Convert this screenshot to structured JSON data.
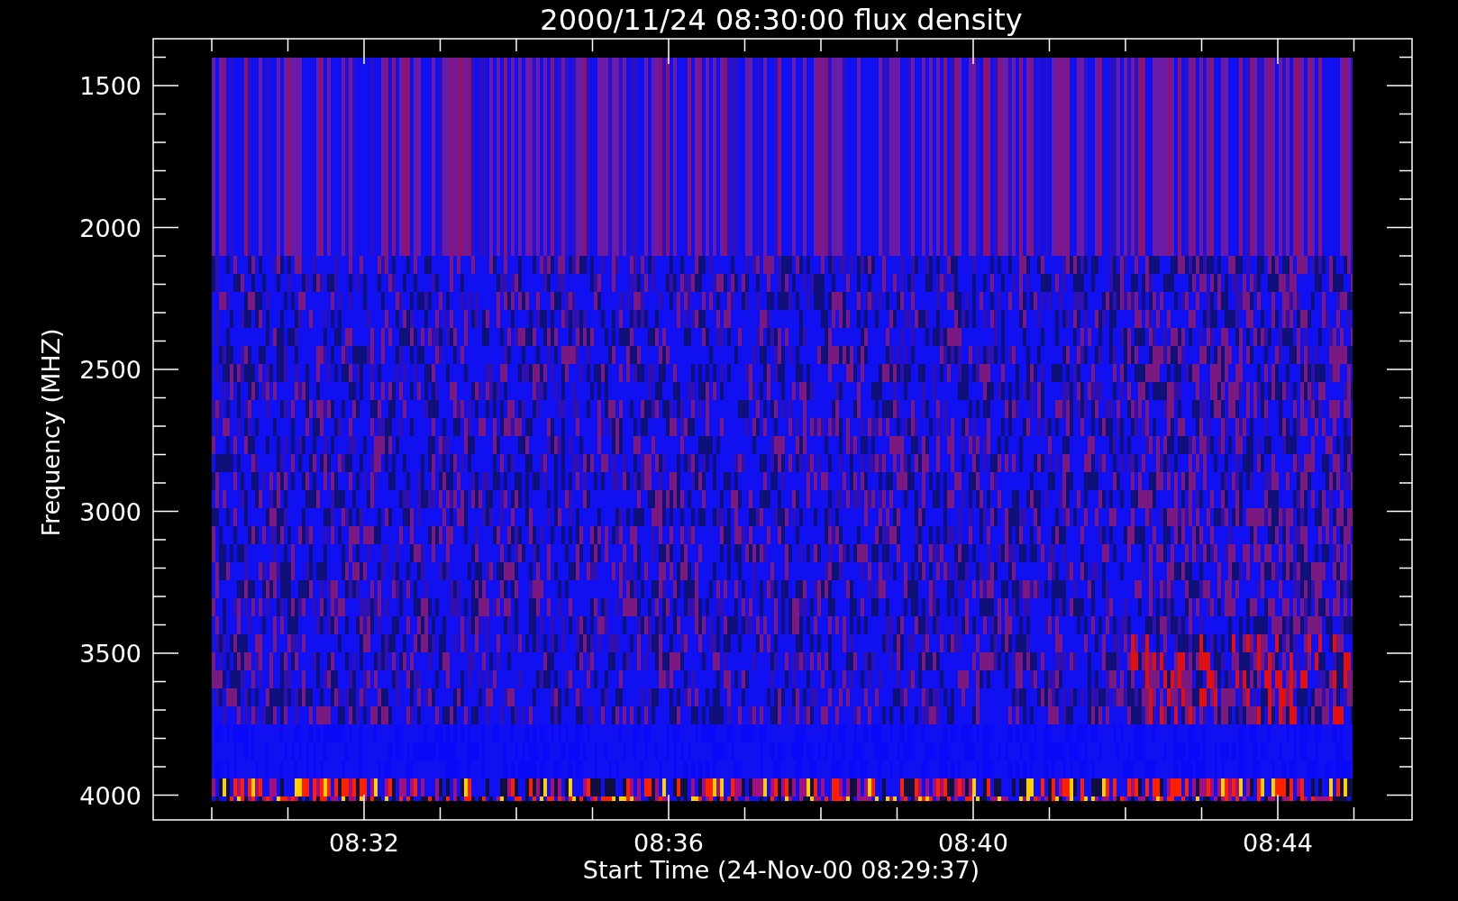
{
  "plot": {
    "title": "2000/11/24 08:30:00 flux density",
    "ylabel": "Frequency (MHZ)",
    "xlabel": "Start Time (24-Nov-00 08:29:37)",
    "yticks": [
      "1500",
      "2000",
      "2500",
      "3000",
      "3500",
      "4000"
    ],
    "xticks": [
      "08:32",
      "08:36",
      "08:40",
      "08:44"
    ]
  }
}
